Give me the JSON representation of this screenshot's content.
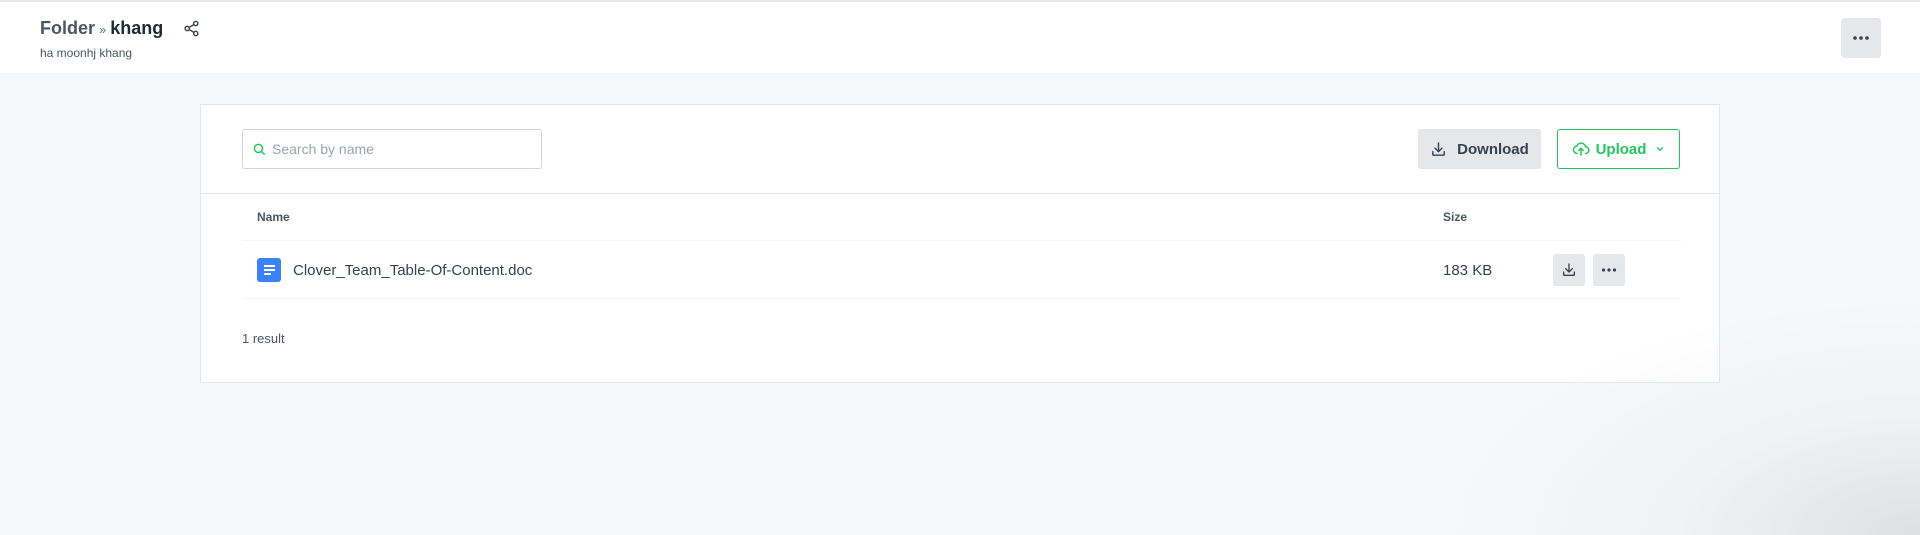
{
  "header": {
    "breadcrumb_root": "Folder",
    "breadcrumb_separator": "»",
    "breadcrumb_current": "khang",
    "owner": "ha moonhj khang",
    "share_icon": "share-icon",
    "menu_icon": "more-horizontal-icon"
  },
  "toolbar": {
    "search_placeholder": "Search by name",
    "search_value": "",
    "download_label": "Download",
    "upload_label": "Upload"
  },
  "table": {
    "columns": {
      "name": "Name",
      "size": "Size"
    },
    "rows": [
      {
        "name": "Clover_Team_Table-Of-Content.doc",
        "size": "183 KB",
        "icon": "document-icon"
      }
    ]
  },
  "results_text": "1 result",
  "colors": {
    "accent_green": "#22c55e",
    "file_icon_blue": "#3b82f6",
    "button_gray": "#e5e7eb"
  }
}
